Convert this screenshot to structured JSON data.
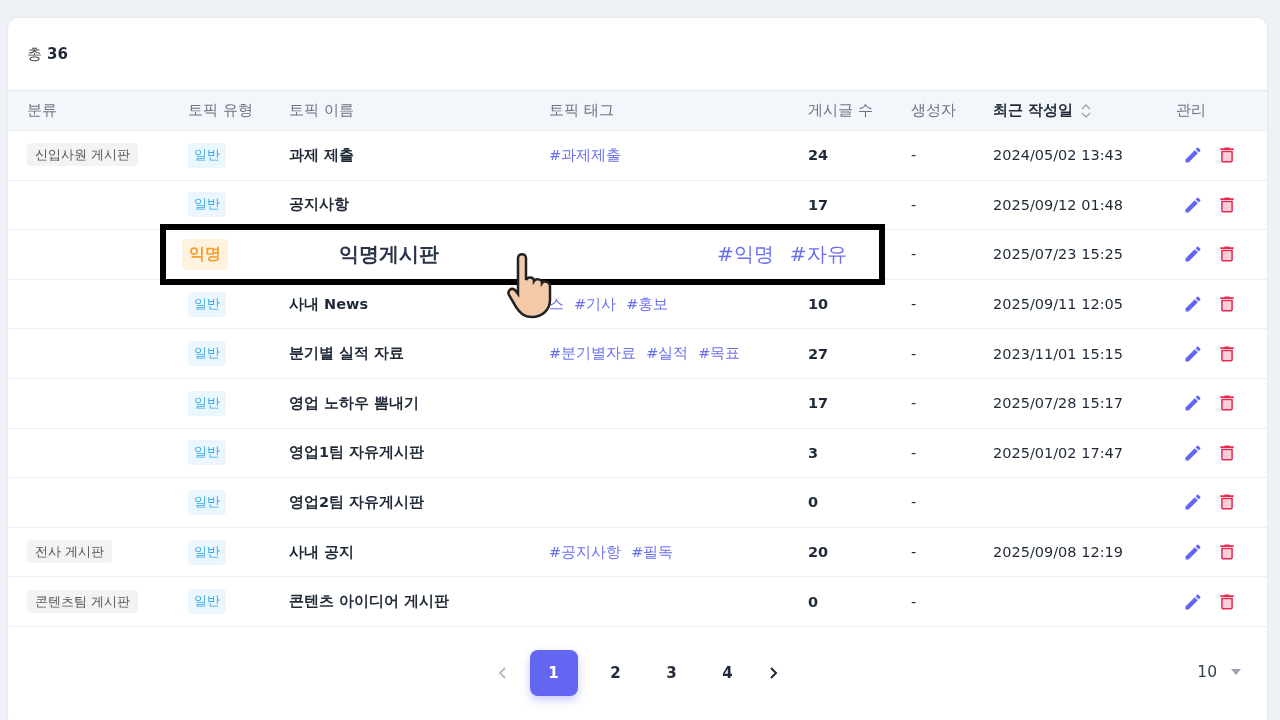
{
  "summary": {
    "label": "총",
    "count": "36"
  },
  "columns": [
    {
      "label": "분류",
      "sortable": false
    },
    {
      "label": "토픽 유형",
      "sortable": false
    },
    {
      "label": "토픽 이름",
      "sortable": false
    },
    {
      "label": "토픽 태그",
      "sortable": false
    },
    {
      "label": "게시글 수",
      "sortable": false
    },
    {
      "label": "생성자",
      "sortable": false
    },
    {
      "label": "최근 작성일",
      "sortable": true
    },
    {
      "label": "관리",
      "sortable": false
    }
  ],
  "rows": [
    {
      "category": "신입사원 게시판",
      "type": {
        "label": "일반",
        "kind": "general"
      },
      "name": "과제 제출",
      "tags": [
        "#과제제출"
      ],
      "count": "24",
      "creator": "-",
      "date": "2024/05/02 13:43",
      "highlighted": false
    },
    {
      "type": {
        "label": "일반",
        "kind": "general"
      },
      "name": "공지사항",
      "tags": [],
      "count": "17",
      "creator": "-",
      "date": "2025/09/12 01:48",
      "highlighted": false
    },
    {
      "type": {
        "label": "익명",
        "kind": "anonymous"
      },
      "name": "익명게시판",
      "tags": [
        "#익명",
        "#자유"
      ],
      "creator": "-",
      "date": "2025/07/23 15:25",
      "highlighted": true
    },
    {
      "type": {
        "label": "일반",
        "kind": "general"
      },
      "name": "사내 News",
      "tags": [
        "스",
        "#기사",
        "#홍보"
      ],
      "count": "10",
      "creator": "-",
      "date": "2025/09/11 12:05",
      "highlighted": false
    },
    {
      "type": {
        "label": "일반",
        "kind": "general"
      },
      "name": "분기별 실적 자료",
      "tags": [
        "#분기별자료",
        "#실적",
        "#목표"
      ],
      "count": "27",
      "creator": "-",
      "date": "2023/11/01 15:15",
      "highlighted": false
    },
    {
      "type": {
        "label": "일반",
        "kind": "general"
      },
      "name": "영업 노하우 뽐내기",
      "tags": [],
      "count": "17",
      "creator": "-",
      "date": "2025/07/28 15:17",
      "highlighted": false
    },
    {
      "type": {
        "label": "일반",
        "kind": "general"
      },
      "name": "영업1팀 자유게시판",
      "tags": [],
      "count": "3",
      "creator": "-",
      "date": "2025/01/02 17:47",
      "highlighted": false
    },
    {
      "type": {
        "label": "일반",
        "kind": "general"
      },
      "name": "영업2팀 자유게시판",
      "tags": [],
      "count": "0",
      "creator": "-",
      "highlighted": false
    },
    {
      "category": "전사 게시판",
      "type": {
        "label": "일반",
        "kind": "general"
      },
      "name": "사내 공지",
      "tags": [
        "#공지사항",
        "#필독"
      ],
      "count": "20",
      "creator": "-",
      "date": "2025/09/08 12:19",
      "highlighted": false
    },
    {
      "category": "콘텐츠팀 게시판",
      "type": {
        "label": "일반",
        "kind": "general"
      },
      "name": "콘텐츠 아이디어 게시판",
      "tags": [],
      "count": "0",
      "creator": "-",
      "highlighted": false
    }
  ],
  "pagination": {
    "prev_disabled": true,
    "next_disabled": false,
    "pages": [
      {
        "label": "1",
        "selected": true
      },
      {
        "label": "2",
        "selected": false
      },
      {
        "label": "3",
        "selected": false
      },
      {
        "label": "4",
        "selected": false
      }
    ],
    "page_size": "10"
  }
}
